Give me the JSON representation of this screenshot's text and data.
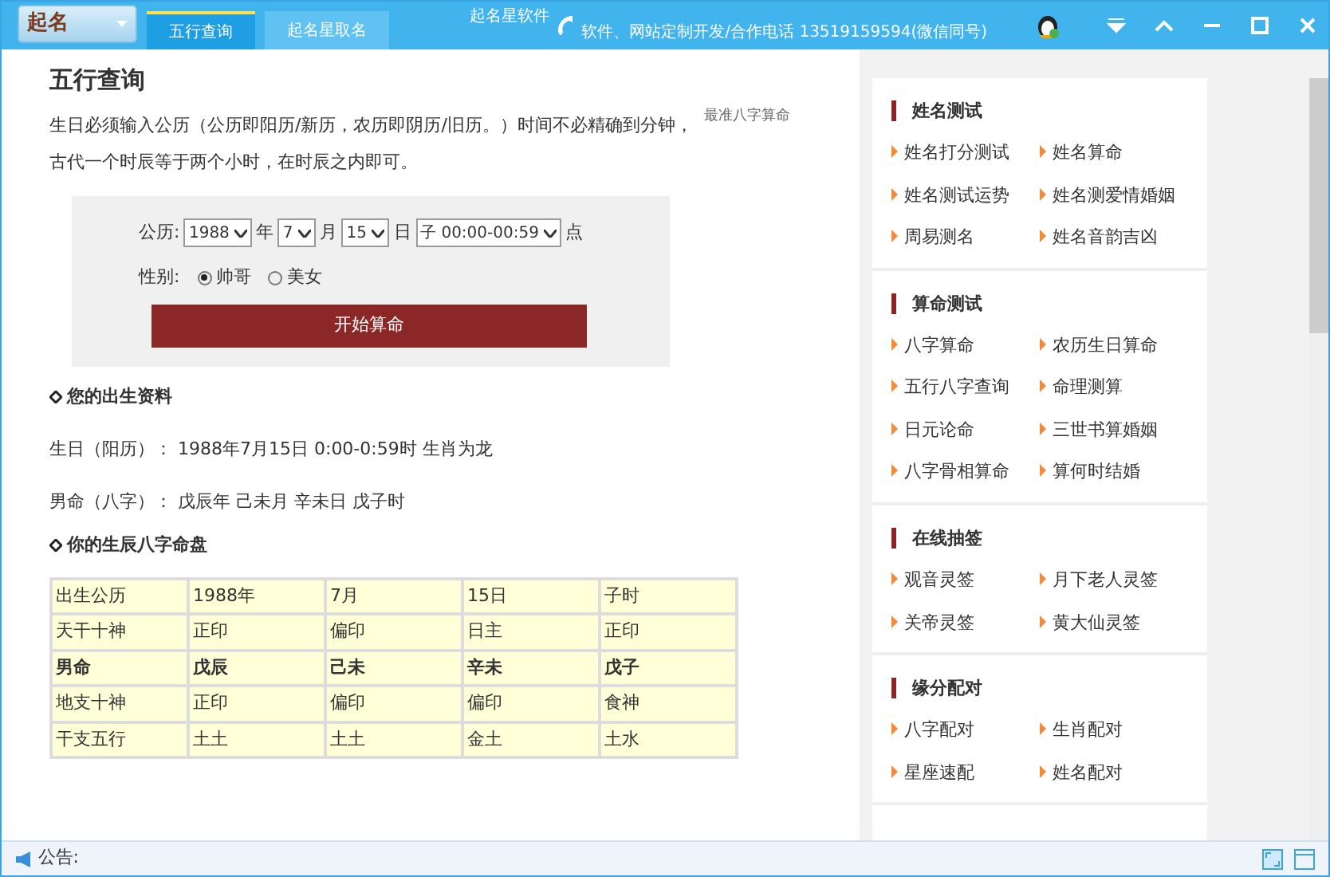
{
  "titlebar": {
    "logo": "起名",
    "tabs": [
      {
        "label": "五行查询",
        "selected": true
      },
      {
        "label": "起名星取名",
        "selected": false
      }
    ],
    "app_name": "起名星软件",
    "contact": "软件、网站定制开发/合作电话 13519159594(微信同号)"
  },
  "main": {
    "title": "五行查询",
    "side_link": "最准八字算命",
    "intro": "生日必须输入公历（公历即阳历/新历，农历即阴历/旧历。）时间不必精确到分钟，古代一个时辰等于两个小时，在时辰之内即可。",
    "form": {
      "calendar_label": "公历:",
      "year": "1988",
      "year_unit": "年",
      "month": "7",
      "month_unit": "月",
      "day": "15",
      "day_unit": "日",
      "hour": "子 00:00-00:59",
      "hour_unit": "点",
      "gender_label": "性别:",
      "genders": [
        {
          "label": "帅哥",
          "selected": true
        },
        {
          "label": "美女",
          "selected": false
        }
      ],
      "submit": "开始算命"
    },
    "birth_heading": "您的出生资料",
    "birth_lines": [
      "生日（阳历）： 1988年7月15日 0:00-0:59时 生肖为龙",
      "男命（八字）： 戊辰年 己未月 辛未日 戊子时"
    ],
    "chart_heading": "你的生辰八字命盘",
    "table": {
      "rows": [
        {
          "bold": false,
          "cells": [
            "出生公历",
            "1988年",
            "7月",
            "15日",
            "子时"
          ]
        },
        {
          "bold": false,
          "cells": [
            "天干十神",
            "正印",
            "偏印",
            "日主",
            "正印"
          ]
        },
        {
          "bold": true,
          "cells": [
            "男命",
            "戊辰",
            "己未",
            "辛未",
            "戊子"
          ]
        },
        {
          "bold": false,
          "cells": [
            "地支十神",
            "正印",
            "偏印",
            "偏印",
            "食神"
          ]
        },
        {
          "bold": false,
          "cells": [
            "干支五行",
            "土土",
            "土土",
            "金土",
            "土水"
          ]
        }
      ]
    }
  },
  "sidebar": {
    "sections": [
      {
        "title": "姓名测试",
        "links": [
          "姓名打分测试",
          "姓名算命",
          "姓名测试运势",
          "姓名测爱情婚姻",
          "周易测名",
          "姓名音韵吉凶"
        ]
      },
      {
        "title": "算命测试",
        "links": [
          "八字算命",
          "农历生日算命",
          "五行八字查询",
          "命理测算",
          "日元论命",
          "三世书算婚姻",
          "八字骨相算命",
          "算何时结婚"
        ]
      },
      {
        "title": "在线抽签",
        "links": [
          "观音灵签",
          "月下老人灵签",
          "关帝灵签",
          "黄大仙灵签"
        ]
      },
      {
        "title": "缘分配对",
        "links": [
          "八字配对",
          "生肖配对",
          "星座速配",
          "姓名配对"
        ]
      }
    ]
  },
  "status_bar": {
    "notice_label": "公告:"
  }
}
